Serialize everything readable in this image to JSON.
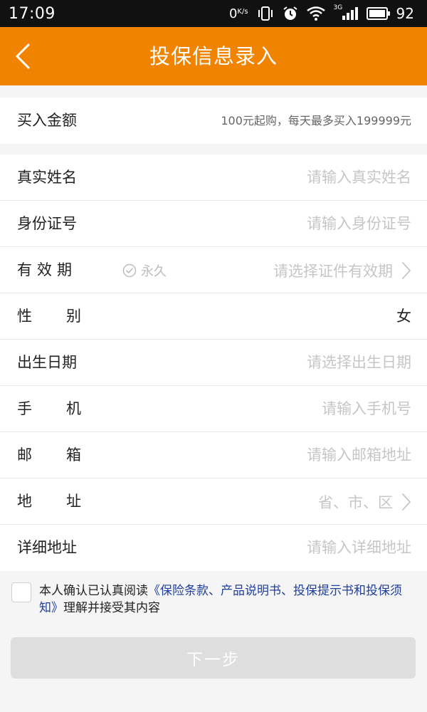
{
  "status_bar": {
    "time": "17:09",
    "net_speed": "0",
    "net_speed_unit": "K/s",
    "battery": "92",
    "network_label": "3G"
  },
  "nav": {
    "title": "投保信息录入",
    "back_icon": "chevron-left-icon"
  },
  "amount": {
    "label": "买入金额",
    "hint": "100元起购，每天最多买入199999元"
  },
  "form": {
    "name": {
      "label": "真实姓名",
      "placeholder": "请输入真实姓名"
    },
    "id_number": {
      "label": "身份证号",
      "placeholder": "请输入身份证号"
    },
    "validity": {
      "label": "有效期",
      "permanent_label": "永久",
      "placeholder": "请选择证件有效期"
    },
    "gender": {
      "label": "性别",
      "value": "女"
    },
    "birth_date": {
      "label": "出生日期",
      "placeholder": "请选择出生日期"
    },
    "phone": {
      "label": "手机",
      "placeholder": "请输入手机号"
    },
    "email": {
      "label": "邮箱",
      "placeholder": "请输入邮箱地址"
    },
    "region": {
      "label": "地址",
      "placeholder": "省、市、区"
    },
    "detail_address": {
      "label": "详细地址",
      "placeholder": "请输入详细地址"
    }
  },
  "agreement": {
    "prefix": "本人确认已认真阅读",
    "link": "《保险条款、产品说明书、投保提示书和投保须知》",
    "suffix": "理解并接受其内容"
  },
  "next_button": {
    "label": "下一步"
  },
  "colors": {
    "brand_orange": "#f08300",
    "link_blue": "#1f3e9e",
    "placeholder_gray": "#c6c6c6",
    "disabled_button": "#dedede"
  }
}
